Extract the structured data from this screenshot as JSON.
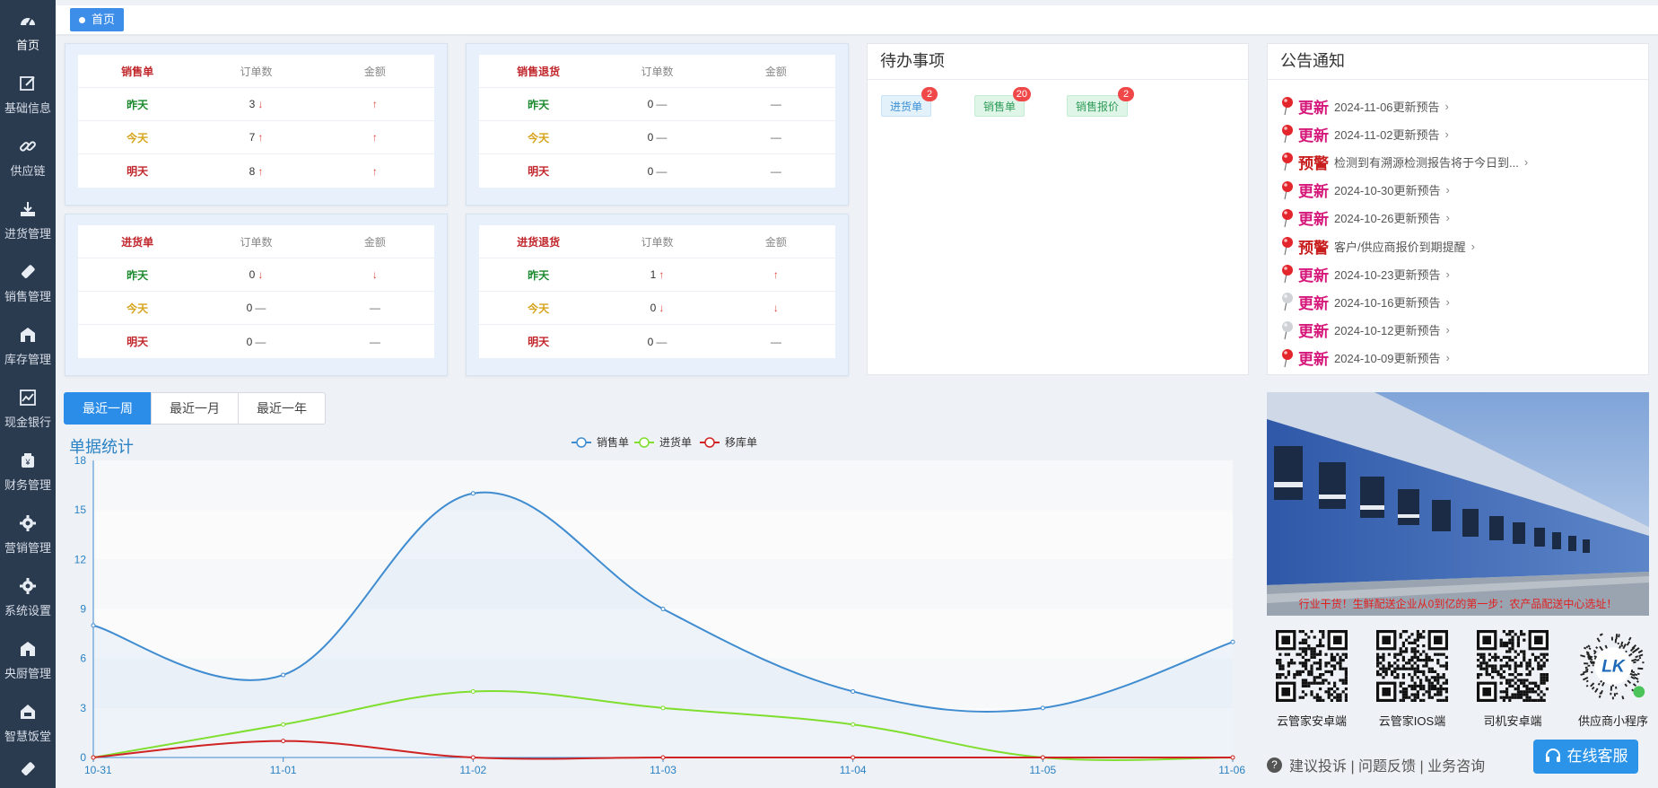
{
  "sidebar": {
    "items": [
      {
        "label": "首页",
        "icon": "dashboard-icon"
      },
      {
        "label": "基础信息",
        "icon": "edit-icon"
      },
      {
        "label": "供应链",
        "icon": "link-icon"
      },
      {
        "label": "进货管理",
        "icon": "download-icon"
      },
      {
        "label": "销售管理",
        "icon": "tag-icon"
      },
      {
        "label": "库存管理",
        "icon": "warehouse-icon"
      },
      {
        "label": "现金银行",
        "icon": "bank-icon"
      },
      {
        "label": "财务管理",
        "icon": "finance-icon"
      },
      {
        "label": "营销管理",
        "icon": "gear-icon"
      },
      {
        "label": "系统设置",
        "icon": "gear-icon"
      },
      {
        "label": "央厨管理",
        "icon": "kitchen-icon"
      },
      {
        "label": "智慧饭堂",
        "icon": "canteen-icon"
      }
    ]
  },
  "breadcrumb": {
    "label": "首页"
  },
  "stat_cards": [
    {
      "header": [
        "销售单",
        "订单数",
        "金额"
      ],
      "rows": [
        {
          "day": "昨天",
          "count": "3",
          "count_trend": "↓",
          "amount_trend": "↑"
        },
        {
          "day": "今天",
          "count": "7",
          "count_trend": "↑",
          "amount_trend": "↑"
        },
        {
          "day": "明天",
          "count": "8",
          "count_trend": "↑",
          "amount_trend": "↑"
        }
      ]
    },
    {
      "header": [
        "销售退货",
        "订单数",
        "金额"
      ],
      "rows": [
        {
          "day": "昨天",
          "count": "0",
          "count_trend": "—",
          "amount_trend": "—"
        },
        {
          "day": "今天",
          "count": "0",
          "count_trend": "—",
          "amount_trend": "—"
        },
        {
          "day": "明天",
          "count": "0",
          "count_trend": "—",
          "amount_trend": "—"
        }
      ]
    },
    {
      "header": [
        "进货单",
        "订单数",
        "金额"
      ],
      "rows": [
        {
          "day": "昨天",
          "count": "0",
          "count_trend": "↓",
          "amount_trend": "↓"
        },
        {
          "day": "今天",
          "count": "0",
          "count_trend": "—",
          "amount_trend": "—"
        },
        {
          "day": "明天",
          "count": "0",
          "count_trend": "—",
          "amount_trend": "—"
        }
      ]
    },
    {
      "header": [
        "进货退货",
        "订单数",
        "金额"
      ],
      "rows": [
        {
          "day": "昨天",
          "count": "1",
          "count_trend": "↑",
          "amount_trend": "↑"
        },
        {
          "day": "今天",
          "count": "0",
          "count_trend": "↓",
          "amount_trend": "↓"
        },
        {
          "day": "明天",
          "count": "0",
          "count_trend": "—",
          "amount_trend": "—"
        }
      ]
    }
  ],
  "todo": {
    "title": "待办事项",
    "items": [
      {
        "label": "进货单",
        "badge": "2"
      },
      {
        "label": "销售单",
        "badge": "20"
      },
      {
        "label": "销售报价",
        "badge": "2"
      }
    ]
  },
  "notices": {
    "title": "公告通知",
    "items": [
      {
        "tag": "更新",
        "text": "2024-11-06更新预告",
        "pin": "red"
      },
      {
        "tag": "更新",
        "text": "2024-11-02更新预告",
        "pin": "red"
      },
      {
        "tag": "预警",
        "text": "检测到有溯源检测报告将于今日到...",
        "pin": "red"
      },
      {
        "tag": "更新",
        "text": "2024-10-30更新预告",
        "pin": "red"
      },
      {
        "tag": "更新",
        "text": "2024-10-26更新预告",
        "pin": "red"
      },
      {
        "tag": "预警",
        "text": "客户/供应商报价到期提醒",
        "pin": "red"
      },
      {
        "tag": "更新",
        "text": "2024-10-23更新预告",
        "pin": "red"
      },
      {
        "tag": "更新",
        "text": "2024-10-16更新预告",
        "pin": "grey"
      },
      {
        "tag": "更新",
        "text": "2024-10-12更新预告",
        "pin": "grey"
      },
      {
        "tag": "更新",
        "text": "2024-10-09更新预告",
        "pin": "red"
      }
    ]
  },
  "range_tabs": [
    "最近一周",
    "最近一月",
    "最近一年"
  ],
  "chart_title": "单据统计",
  "chart_data": {
    "type": "line",
    "categories": [
      "10-31",
      "11-01",
      "11-02",
      "11-03",
      "11-04",
      "11-05",
      "11-06"
    ],
    "ylim": [
      0,
      18
    ],
    "yticks": [
      0,
      3,
      6,
      9,
      12,
      15,
      18
    ],
    "smooth": true,
    "legend_position": "top-center",
    "series": [
      {
        "name": "销售单",
        "color": "#3f8cd0",
        "values": [
          8,
          5,
          16,
          9,
          4,
          3,
          7
        ],
        "area": true
      },
      {
        "name": "进货单",
        "color": "#7fde2e",
        "values": [
          0,
          2,
          4,
          3,
          2,
          0,
          0
        ]
      },
      {
        "name": "移库单",
        "color": "#d02323",
        "values": [
          0,
          1,
          0,
          0,
          0,
          0,
          0
        ]
      }
    ]
  },
  "promo": {
    "caption": "行业干货！生鲜配送企业从0到亿的第一步：农产品配送中心选址！"
  },
  "qr_codes": [
    {
      "label": "云管家安卓端"
    },
    {
      "label": "云管家IOS端"
    },
    {
      "label": "司机安卓端"
    },
    {
      "label": "供应商小程序",
      "logo": "LK"
    }
  ],
  "footer": {
    "help_icon": "?",
    "links": "建议投诉 | 问题反馈 | 业务咨询"
  },
  "support_button": {
    "label": "在线客服"
  },
  "colors": {
    "sidebar": "#2a3a4f",
    "accent": "#2b8de7",
    "up": "#e0443a"
  }
}
